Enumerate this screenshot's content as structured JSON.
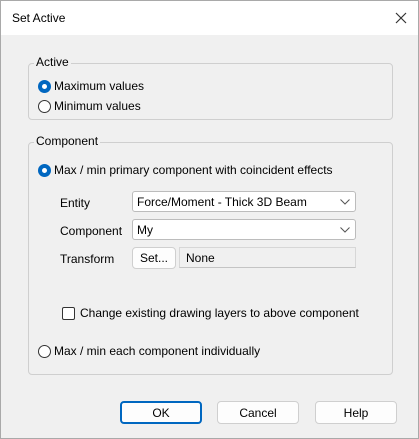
{
  "window": {
    "title": "Set Active",
    "close_icon": "close-icon"
  },
  "active_group": {
    "legend": "Active",
    "options": [
      {
        "label": "Maximum values",
        "checked": true
      },
      {
        "label": "Minimum values",
        "checked": false
      }
    ]
  },
  "component_group": {
    "legend": "Component",
    "primary_option": {
      "label": "Max / min primary component with coincident effects",
      "checked": true
    },
    "entity": {
      "label": "Entity",
      "value": "Force/Moment - Thick 3D Beam"
    },
    "component": {
      "label": "Component",
      "value": "My"
    },
    "transform": {
      "label": "Transform",
      "button": "Set...",
      "value": "None"
    },
    "change_layers": {
      "label": "Change existing drawing layers to above component",
      "checked": false
    },
    "individual_option": {
      "label": "Max / min each component individually",
      "checked": false
    }
  },
  "buttons": {
    "ok": "OK",
    "cancel": "Cancel",
    "help": "Help"
  },
  "colors": {
    "accent": "#0067c0",
    "dialog_bg": "#f0f0f0",
    "titlebar_bg": "#ffffff"
  }
}
